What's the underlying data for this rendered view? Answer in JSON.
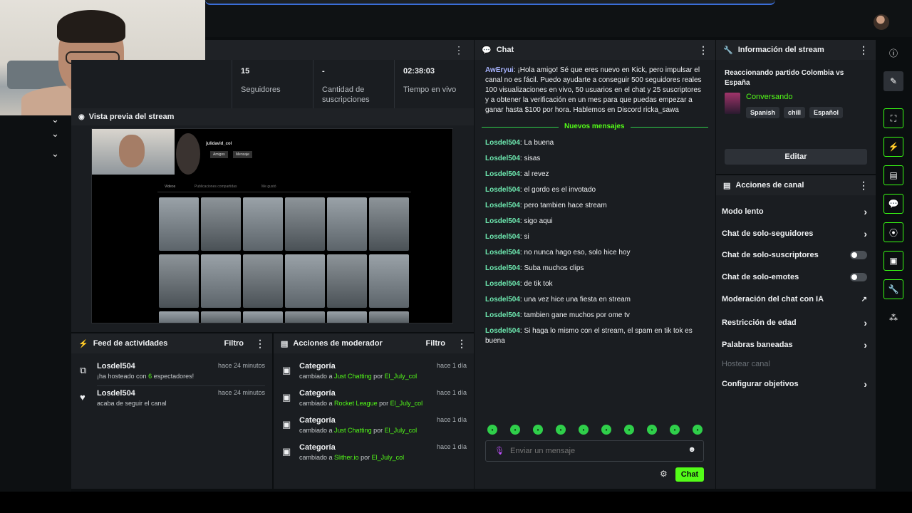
{
  "stats": [
    {
      "value": "15",
      "label": "Seguidores"
    },
    {
      "value": "-",
      "label": "Cantidad de suscripciones"
    },
    {
      "value": "02:38:03",
      "label": "Tiempo en vivo"
    }
  ],
  "preview": {
    "title": "Vista previa del stream",
    "profile_name": "julidavid_col",
    "profile_follow": "Amigos",
    "profile_msg": "Mensaje",
    "tabs": [
      "Videos",
      "Publicaciones compartidas",
      "Me gustó"
    ]
  },
  "chat": {
    "title": "Chat",
    "first_user": "AwEryui",
    "first_text": "¡Hola amigo! Sé que eres nuevo en Kick, pero impulsar el canal no es fácil. Puedo ayudarte a conseguir 500 seguidores reales 100 visualizaciones en vivo, 50 usuarios en el chat y 25 suscriptores y a obtener la verificación en un mes para que puedas empezar a ganar hasta $100 por hora. Hablemos en Discord ricka_sawa",
    "new_messages": "Nuevos mensajes",
    "messages": [
      {
        "user": "Losdel504",
        "text": "La buena"
      },
      {
        "user": "Losdel504",
        "text": "sisas"
      },
      {
        "user": "Losdel504",
        "text": "al revez"
      },
      {
        "user": "Losdel504",
        "text": "el gordo es el invotado"
      },
      {
        "user": "Losdel504",
        "text": "pero tambien hace stream"
      },
      {
        "user": "Losdel504",
        "text": "sigo aqui"
      },
      {
        "user": "Losdel504",
        "text": "si"
      },
      {
        "user": "Losdel504",
        "text": "no nunca hago eso, solo hice hoy"
      },
      {
        "user": "Losdel504",
        "text": "Suba muchos clips"
      },
      {
        "user": "Losdel504",
        "text": "de tik tok"
      },
      {
        "user": "Losdel504",
        "text": "una vez hice una fiesta en stream"
      },
      {
        "user": "Losdel504",
        "text": "tambien gane muchos por ome tv"
      },
      {
        "user": "Losdel504",
        "text": "Si haga lo mismo con el stream, el spam en tik tok es buena"
      }
    ],
    "input_placeholder": "Enviar un mensaje",
    "send_label": "Chat"
  },
  "info": {
    "title": "Información del stream",
    "stream_title": "Reaccionando partido Colombia vs España",
    "category": "Conversando",
    "tags": [
      "Spanish",
      "chill",
      "Español"
    ],
    "edit_label": "Editar"
  },
  "actions": {
    "title": "Acciones de canal",
    "items": [
      {
        "label": "Modo lento",
        "kind": "chevron"
      },
      {
        "label": "Chat de solo-seguidores",
        "kind": "chevron"
      },
      {
        "label": "Chat de solo-suscriptores",
        "kind": "toggle"
      },
      {
        "label": "Chat de solo-emotes",
        "kind": "toggle"
      },
      {
        "label": "Moderación del chat con IA",
        "kind": "external"
      },
      {
        "label": "Restricción de edad",
        "kind": "chevron"
      },
      {
        "label": "Palabras baneadas",
        "kind": "chevron"
      },
      {
        "label": "Hostear canal",
        "kind": "disabled"
      },
      {
        "label": "Configurar objetivos",
        "kind": "chevron"
      }
    ]
  },
  "feed": {
    "title": "Feed de actividades",
    "filter_label": "Filtro",
    "items": [
      {
        "user": "Losdel504",
        "time": "hace 24 minutos",
        "pre": "¡ha hosteado con",
        "count": "6",
        "post": "espectadores!"
      },
      {
        "user": "Losdel504",
        "time": "hace 24 minutos",
        "pre": "acaba de seguir el canal",
        "count": "",
        "post": ""
      }
    ]
  },
  "mod": {
    "title": "Acciones de moderador",
    "filter_label": "Filtro",
    "items": [
      {
        "title": "Categoría",
        "time": "hace 1 día",
        "changed": "cambiado a",
        "category": "Just Chatting",
        "by": "por",
        "user": "El_July_col"
      },
      {
        "title": "Categoría",
        "time": "hace 1 día",
        "changed": "cambiado a",
        "category": "Rocket League",
        "by": "por",
        "user": "El_July_col"
      },
      {
        "title": "Categoría",
        "time": "hace 1 día",
        "changed": "cambiado a",
        "category": "Just Chatting",
        "by": "por",
        "user": "El_July_col"
      },
      {
        "title": "Categoría",
        "time": "hace 1 día",
        "changed": "cambiado a",
        "category": "Slither.io",
        "by": "por",
        "user": "El_July_col"
      }
    ]
  },
  "colors": {
    "accent": "#53fc18",
    "username": "#6ee9b0",
    "panel": "#1a1d21"
  }
}
